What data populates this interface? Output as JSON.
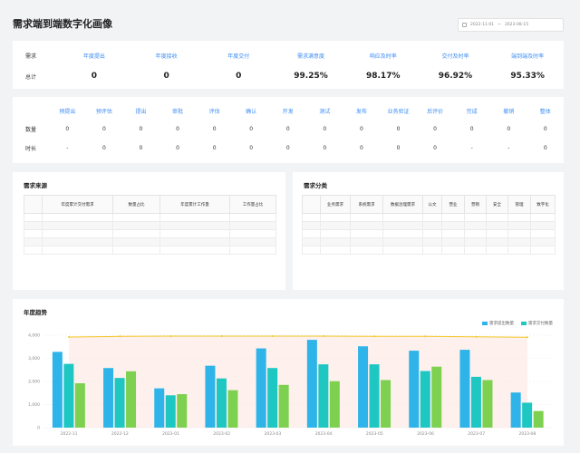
{
  "page": {
    "title": "需求端到端数字化画像"
  },
  "date_range": {
    "start": "2022-11-01",
    "sep": "~",
    "end": "2023-08-15"
  },
  "metrics": {
    "row_label_head": "需求",
    "row_label_val": "总计",
    "headers": [
      "年度提出",
      "年度接收",
      "年度交付",
      "需求满意度",
      "响应及时率",
      "交付及时率",
      "端到端及时率"
    ],
    "values": [
      "0",
      "0",
      "0",
      "99.25%",
      "98.17%",
      "96.92%",
      "95.33%"
    ]
  },
  "stages": {
    "headers": [
      "预提出",
      "预评估",
      "提出",
      "审批",
      "评估",
      "确认",
      "开发",
      "测试",
      "发布",
      "业务验证",
      "后评价",
      "完成",
      "撤销",
      "整体"
    ],
    "rows": [
      {
        "label": "数量",
        "values": [
          "0",
          "0",
          "0",
          "0",
          "0",
          "0",
          "0",
          "0",
          "0",
          "0",
          "0",
          "0",
          "0",
          "0"
        ]
      },
      {
        "label": "时长",
        "values": [
          "-",
          "0",
          "0",
          "0",
          "0",
          "0",
          "0",
          "0",
          "0",
          "0",
          "0",
          "-",
          "-",
          "0"
        ]
      }
    ]
  },
  "source": {
    "title": "需求来源",
    "headers": [
      "年度累计交付需求",
      "数量占比",
      "年度累计工作量",
      "工作量占比"
    ]
  },
  "category": {
    "title": "需求分类",
    "headers": [
      "业务需求",
      "系统需求",
      "数据治理需求",
      "公文",
      "营业",
      "营销",
      "安全",
      "管理",
      "数字化"
    ]
  },
  "trend": {
    "title": "年度趋势",
    "legend": [
      "需求提出数量",
      "需求交付数量"
    ]
  },
  "colors": {
    "blue": "#2fb4ea",
    "teal": "#1ec7c2",
    "green": "#7ed150",
    "line": "#f3c623",
    "accent": "#3f8ef5"
  },
  "chart_data": {
    "type": "bar",
    "categories": [
      "2022-11",
      "2022-12",
      "2023-01",
      "2023-02",
      "2023-03",
      "2023-04",
      "2023-05",
      "2023-06",
      "2023-07",
      "2023-08"
    ],
    "ylim": [
      0,
      4000
    ],
    "yticks": [
      "0",
      "1,000",
      "2,000",
      "3,000",
      "4,000"
    ],
    "series": [
      {
        "name": "",
        "values": [
          3280,
          2580,
          1700,
          2680,
          3430,
          3800,
          3520,
          3330,
          3370,
          1520
        ],
        "color": "#2fb4ea"
      },
      {
        "name": "",
        "values": [
          2760,
          2150,
          1400,
          2130,
          2580,
          2740,
          2740,
          2450,
          2200,
          1080
        ],
        "color": "#1ec7c2"
      },
      {
        "name": "",
        "values": [
          1920,
          2440,
          1450,
          1620,
          1850,
          2010,
          2060,
          2640,
          2060,
          720
        ],
        "color": "#7ed150"
      }
    ],
    "line": {
      "values": [
        3920,
        3950,
        3960,
        3960,
        3960,
        3960,
        3950,
        3950,
        3930,
        3910
      ],
      "color": "#f3c623"
    }
  }
}
